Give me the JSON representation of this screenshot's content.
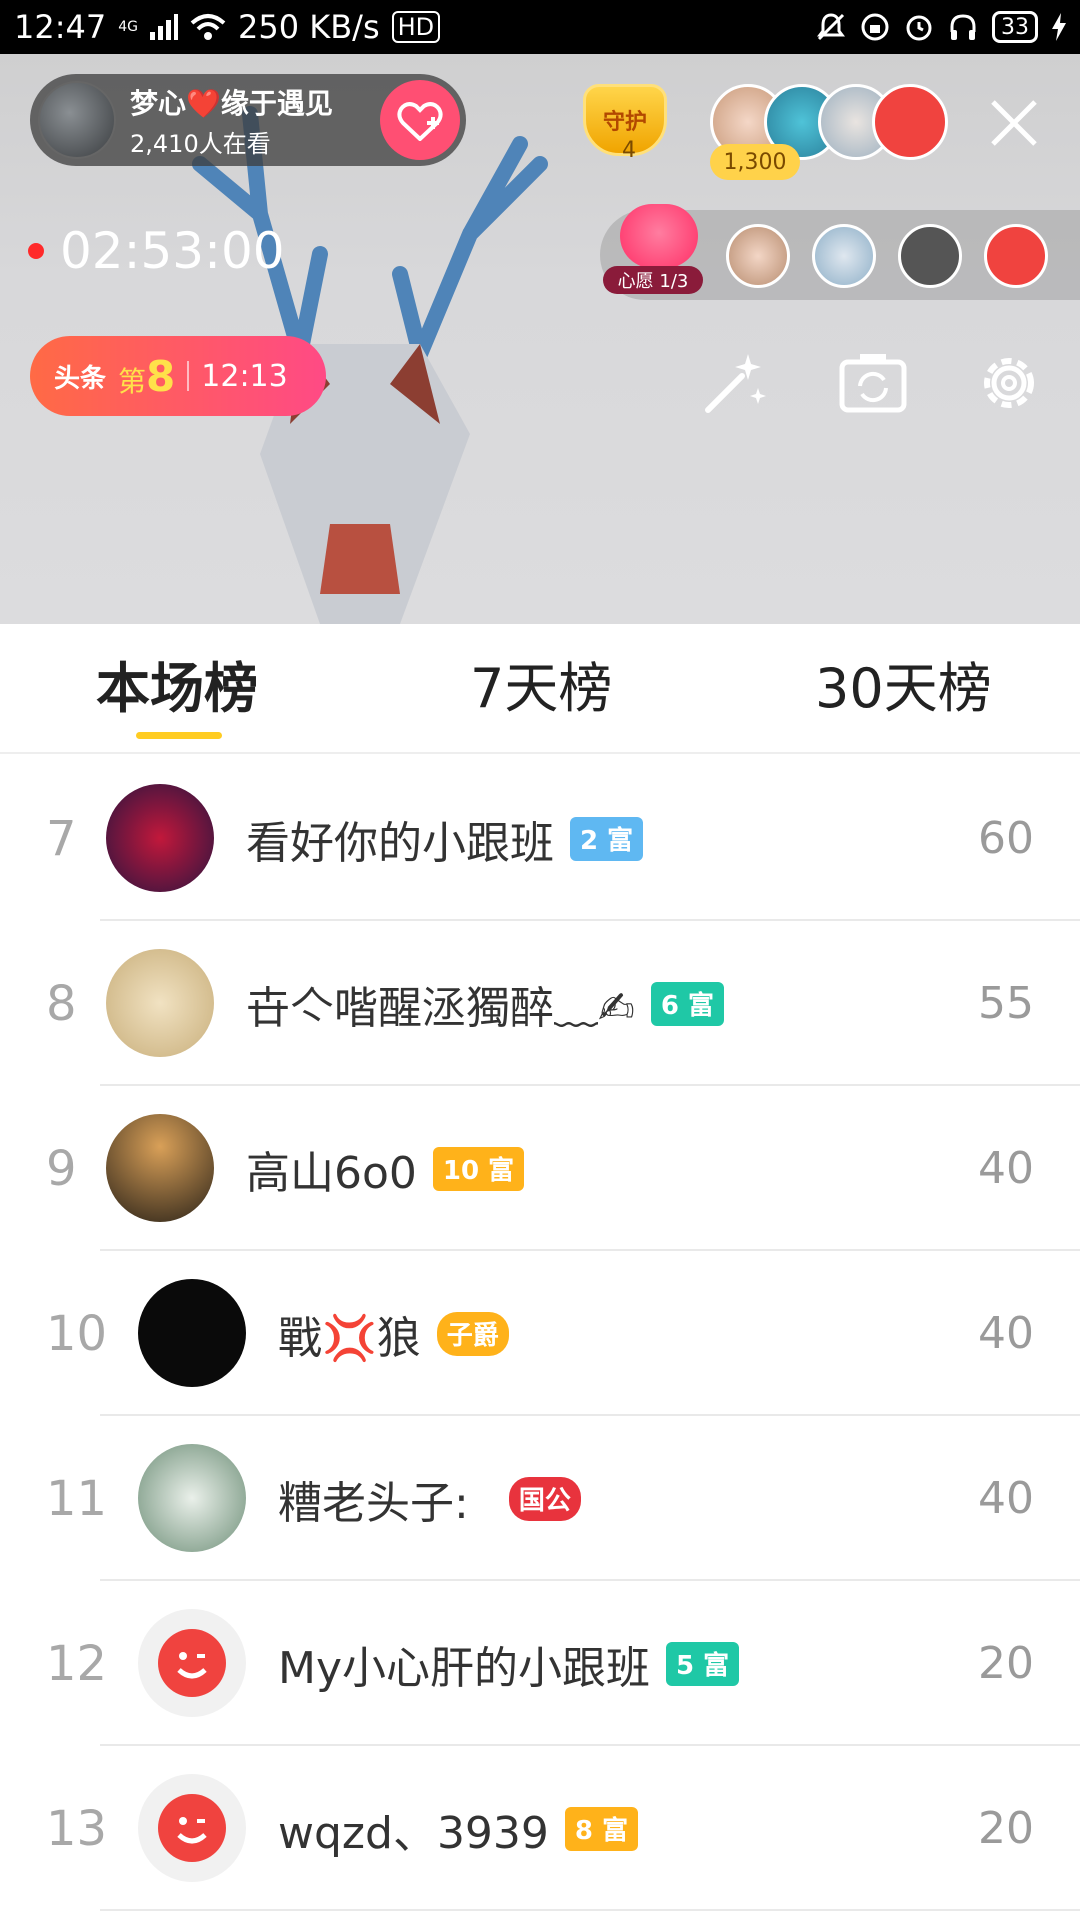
{
  "status_bar": {
    "time": "12:47",
    "network": "4G",
    "speed": "250 KB/s",
    "hd": "HD",
    "battery": "33"
  },
  "room": {
    "host_name": "梦心❤️缘于遇见",
    "viewers": "2,410人在看",
    "guard_label": "守护",
    "guard_count": "4",
    "fans_count": "1,300",
    "live_timer": "02:53:00",
    "wish_label": "心愿 1/3",
    "headline_label": "头条",
    "headline_rank_prefix": "第",
    "headline_rank": "8",
    "headline_time": "12:13"
  },
  "colors": {
    "accent_pink": "#ff4f73",
    "tab_underline": "#ffcc22",
    "rank_gray": "#a8a8a8"
  },
  "icons": {
    "follow": "heart-plus-icon",
    "close": "close-icon",
    "beauty": "magic-wand-icon",
    "camera_flip": "camera-switch-icon",
    "settings": "gear-icon"
  },
  "tabs": [
    {
      "label": "本场榜",
      "active": true
    },
    {
      "label": "7天榜",
      "active": false
    },
    {
      "label": "30天榜",
      "active": false
    }
  ],
  "ranking": [
    {
      "rank": "7",
      "name": "看好你的小跟班",
      "badge": "2 富",
      "badge_color": "#5fb8f2",
      "score": "60"
    },
    {
      "rank": "8",
      "name": "卋亽喈醒洆獨醉﹏✍",
      "badge": "6 富",
      "badge_color": "#1fc8a6",
      "score": "55"
    },
    {
      "rank": "9",
      "name": "高山6o0",
      "badge": "10 富",
      "badge_color": "#ffb21a",
      "score": "40"
    },
    {
      "rank": "10",
      "name": "戰💢狼",
      "badge": "子爵",
      "badge_color": "#ffb21a",
      "score": "40"
    },
    {
      "rank": "11",
      "name": "糟老头子:",
      "badge": "国公",
      "badge_color": "#e8333d",
      "score": "40"
    },
    {
      "rank": "12",
      "name": "My小心肝的小跟班",
      "badge": "5 富",
      "badge_color": "#1fc8a6",
      "score": "20"
    },
    {
      "rank": "13",
      "name": "wqzd、3939",
      "badge": "8 富",
      "badge_color": "#ffb21a",
      "score": "20"
    }
  ]
}
